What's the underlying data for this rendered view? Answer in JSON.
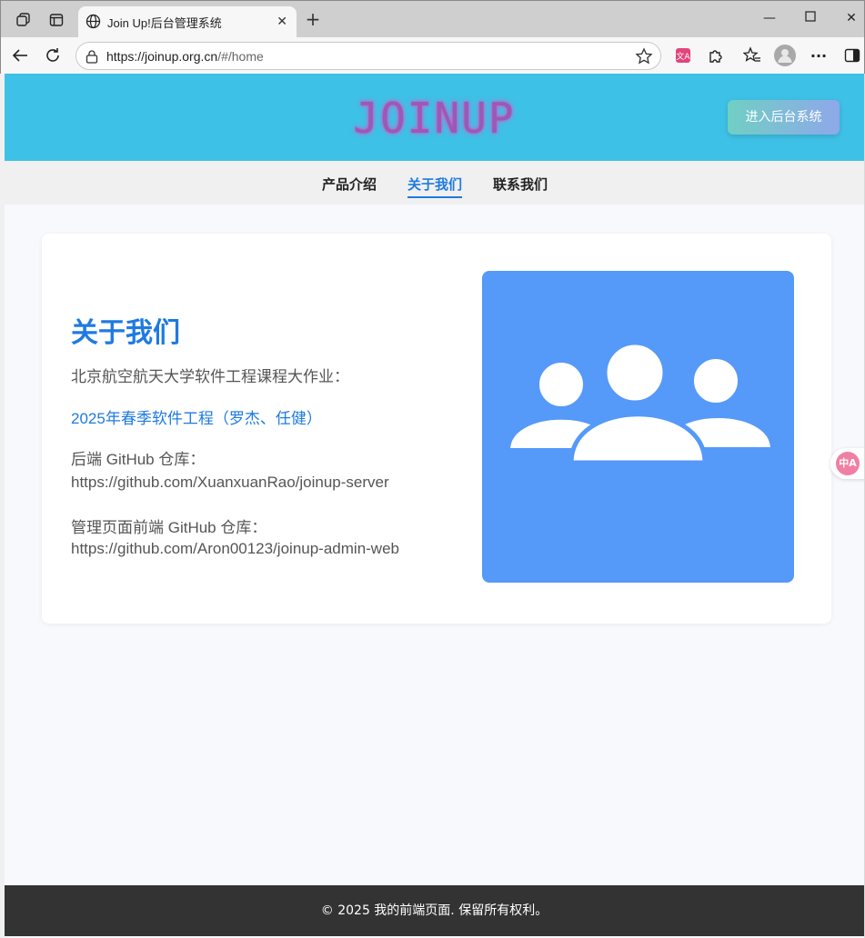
{
  "browser": {
    "tab_title": "Join Up!后台管理系统",
    "url_host": "https://joinup.org.cn",
    "url_path": "/#/home",
    "icons": [
      "workspaces-icon",
      "tab-actions-icon",
      "globe-icon",
      "close-icon",
      "new-tab-icon",
      "minimize-icon",
      "maximize-icon",
      "window-close-icon",
      "back-icon",
      "refresh-icon",
      "lock-icon",
      "star-icon",
      "translate-extension-icon",
      "extensions-icon",
      "favorites-icon",
      "profile-avatar",
      "more-icon",
      "sidebar-icon"
    ]
  },
  "site": {
    "logo": "JOINUP",
    "admin_button": "进入后台系统",
    "nav": [
      {
        "label": "产品介绍",
        "active": false
      },
      {
        "label": "关于我们",
        "active": true
      },
      {
        "label": "联系我们",
        "active": false
      }
    ],
    "about": {
      "heading": "关于我们",
      "intro": "北京航空航天大学软件工程课程大作业：",
      "course": "2025年春季软件工程（罗杰、任健）",
      "backend_label": "后端 GitHub 仓库：",
      "backend_url": "https://github.com/XuanxuanRao/joinup-server",
      "admin_label": "管理页面前端 GitHub 仓库：",
      "admin_url": "https://github.com/Aron00123/joinup-admin-web",
      "image_icon": "users-group-icon"
    },
    "translate_fab": "中A",
    "footer": "© 2025 我的前端页面. 保留所有权利。"
  },
  "colors": {
    "header_bg": "#3ec1e6",
    "accent": "#1f7ae0",
    "image_bg": "#5599f9",
    "footer_bg": "#333333"
  }
}
